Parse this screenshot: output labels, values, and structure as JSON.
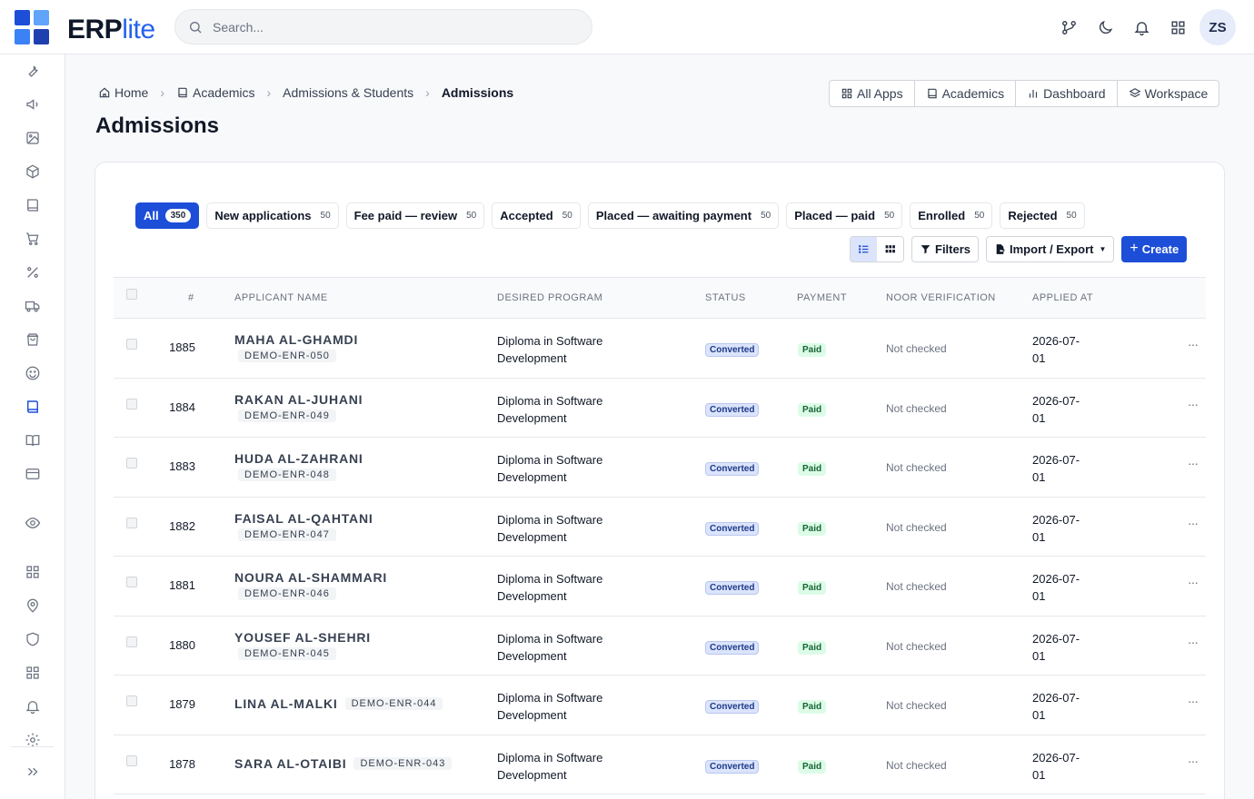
{
  "app": {
    "logo_text_main": "ERP",
    "logo_text_accent": "lite"
  },
  "search": {
    "placeholder": "Search..."
  },
  "user": {
    "initials": "ZS"
  },
  "topbar_icons": [
    "git-branch-icon",
    "moon-icon",
    "bell-icon",
    "apps-grid-icon"
  ],
  "sidebar_icons": [
    "wrench-icon",
    "megaphone-icon",
    "image-icon",
    "box-icon",
    "book-icon",
    "cart-icon",
    "percent-icon",
    "truck-icon",
    "shopping-bag-icon",
    "smile-icon",
    "book-active-icon",
    "book-open-icon",
    "credit-card-icon",
    "eye-icon",
    "grid-icon",
    "map-pin-icon",
    "shield-icon",
    "grid-icon",
    "bell-icon",
    "gear-icon",
    "expand-icon"
  ],
  "breadcrumb": {
    "home": "Home",
    "academics": "Academics",
    "section": "Admissions & Students",
    "current": "Admissions"
  },
  "page": {
    "title": "Admissions"
  },
  "quick_links": {
    "all_apps": "All Apps",
    "academics": "Academics",
    "dashboard": "Dashboard",
    "workspace": "Workspace"
  },
  "tabs": [
    {
      "label": "All",
      "count": "350"
    },
    {
      "label": "New applications",
      "count": "50"
    },
    {
      "label": "Fee paid — review",
      "count": "50"
    },
    {
      "label": "Accepted",
      "count": "50"
    },
    {
      "label": "Placed — awaiting payment",
      "count": "50"
    },
    {
      "label": "Placed — paid",
      "count": "50"
    },
    {
      "label": "Enrolled",
      "count": "50"
    },
    {
      "label": "Rejected",
      "count": "50"
    }
  ],
  "toolbar": {
    "filters": "Filters",
    "import_export": "Import / Export",
    "create": "Create"
  },
  "columns": {
    "num": "#",
    "name": "APPLICANT NAME",
    "program": "DESIRED PROGRAM",
    "status": "STATUS",
    "payment": "PAYMENT",
    "noor": "NOOR VERIFICATION",
    "applied": "APPLIED AT"
  },
  "rows": [
    {
      "num": "1885",
      "name": "MAHA AL-GHAMDI",
      "code": "DEMO-ENR-050",
      "program_l1": "Diploma in Software",
      "program_l2": "Development",
      "status": "Converted",
      "payment": "Paid",
      "noor": "Not checked",
      "applied_l1": "2026-07-",
      "applied_l2": "01"
    },
    {
      "num": "1884",
      "name": "RAKAN AL-JUHANI",
      "code": "DEMO-ENR-049",
      "program_l1": "Diploma in Software",
      "program_l2": "Development",
      "status": "Converted",
      "payment": "Paid",
      "noor": "Not checked",
      "applied_l1": "2026-07-",
      "applied_l2": "01"
    },
    {
      "num": "1883",
      "name": "HUDA AL-ZAHRANI",
      "code": "DEMO-ENR-048",
      "program_l1": "Diploma in Software",
      "program_l2": "Development",
      "status": "Converted",
      "payment": "Paid",
      "noor": "Not checked",
      "applied_l1": "2026-07-",
      "applied_l2": "01"
    },
    {
      "num": "1882",
      "name": "FAISAL AL-QAHTANI",
      "code": "DEMO-ENR-047",
      "program_l1": "Diploma in Software",
      "program_l2": "Development",
      "status": "Converted",
      "payment": "Paid",
      "noor": "Not checked",
      "applied_l1": "2026-07-",
      "applied_l2": "01"
    },
    {
      "num": "1881",
      "name": "NOURA AL-SHAMMARI",
      "code": "DEMO-ENR-046",
      "program_l1": "Diploma in Software",
      "program_l2": "Development",
      "status": "Converted",
      "payment": "Paid",
      "noor": "Not checked",
      "applied_l1": "2026-07-",
      "applied_l2": "01"
    },
    {
      "num": "1880",
      "name": "YOUSEF AL-SHEHRI",
      "code": "DEMO-ENR-045",
      "program_l1": "Diploma in Software",
      "program_l2": "Development",
      "status": "Converted",
      "payment": "Paid",
      "noor": "Not checked",
      "applied_l1": "2026-07-",
      "applied_l2": "01"
    },
    {
      "num": "1879",
      "name": "LINA AL-MALKI",
      "code": "DEMO-ENR-044",
      "program_l1": "Diploma in Software",
      "program_l2": "Development",
      "status": "Converted",
      "payment": "Paid",
      "noor": "Not checked",
      "applied_l1": "2026-07-",
      "applied_l2": "01"
    },
    {
      "num": "1878",
      "name": "SARA AL-OTAIBI",
      "code": "DEMO-ENR-043",
      "program_l1": "Diploma in Software",
      "program_l2": "Development",
      "status": "Converted",
      "payment": "Paid",
      "noor": "Not checked",
      "applied_l1": "2026-07-",
      "applied_l2": "01"
    }
  ]
}
